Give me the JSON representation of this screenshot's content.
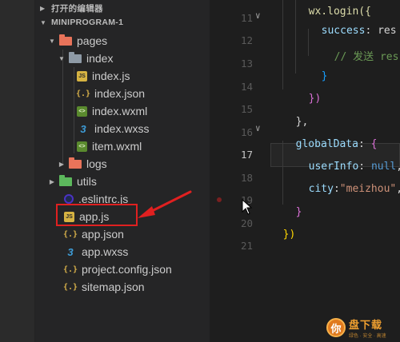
{
  "explorer": {
    "open_editors_label": "打开的编辑器",
    "project_label": "MINIPROGRAM-1",
    "items": [
      {
        "label": "pages",
        "type": "folder-open",
        "color": "#e8735a"
      },
      {
        "label": "index",
        "type": "folder-open",
        "color": "#8e9aa6"
      },
      {
        "label": "index.js",
        "type": "js"
      },
      {
        "label": "index.json",
        "type": "json"
      },
      {
        "label": "index.wxml",
        "type": "wxml"
      },
      {
        "label": "index.wxss",
        "type": "wxss"
      },
      {
        "label": "item.wxml",
        "type": "wxml"
      },
      {
        "label": "logs",
        "type": "folder",
        "color": "#e8735a"
      },
      {
        "label": "utils",
        "type": "folder",
        "color": "#5cb85c"
      },
      {
        "label": ".eslintrc.js",
        "type": "eslint"
      },
      {
        "label": "app.js",
        "type": "js"
      },
      {
        "label": "app.json",
        "type": "json"
      },
      {
        "label": "app.wxss",
        "type": "wxss"
      },
      {
        "label": "project.config.json",
        "type": "json"
      },
      {
        "label": "sitemap.json",
        "type": "json"
      }
    ]
  },
  "editor": {
    "active_line": "17",
    "line_numbers": [
      "11",
      "12",
      "13",
      "14",
      "15",
      "16",
      "17",
      "18",
      "19",
      "20",
      "21"
    ],
    "tokens": {
      "l10_call": "wx.login({",
      "l11_key": "success",
      "l11_rest": ": res =>",
      "l12_comment": "// 发送 res.c",
      "l13": "}",
      "l14": "})",
      "l15": "},",
      "l16_key": "globalData",
      "l16_rest": ": ",
      "l16_brace": "{",
      "l17_key": "userInfo",
      "l17_sep": ": ",
      "l17_val": "null",
      "l17_comma": ",",
      "l18_key": "city",
      "l18_sep": ":",
      "l18_val": "\"meizhou\"",
      "l18_comma": ",",
      "l19": "}",
      "l20": "})"
    }
  },
  "watermark": {
    "badge": "你",
    "main": "盘下载",
    "sub": "绿色 · 安全 · 高速"
  },
  "colors": {
    "highlight": "#e02020",
    "string": "#ce9178",
    "keyword": "#569cd6",
    "property": "#9cdcfe"
  }
}
